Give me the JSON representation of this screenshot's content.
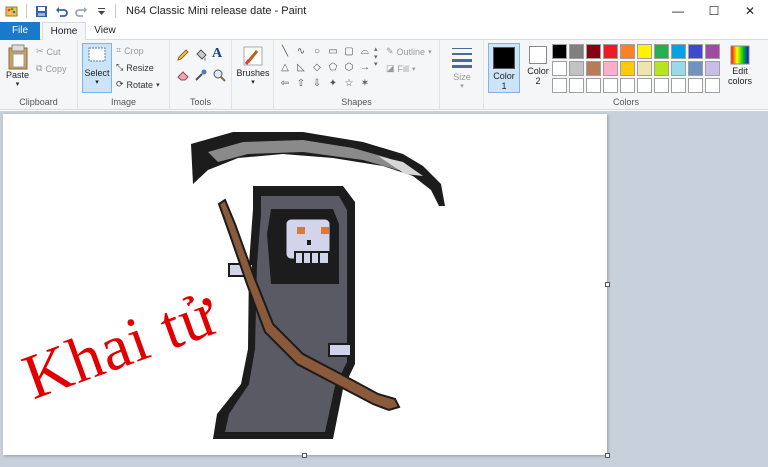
{
  "window": {
    "title": "N64 Classic Mini release date - Paint",
    "quick_access": [
      "paint-app-icon",
      "save-icon",
      "undo-icon",
      "redo-icon",
      "customize-qat-icon"
    ],
    "controls": {
      "minimize": "—",
      "maximize": "☐",
      "close": "✕"
    }
  },
  "tabs": {
    "file": "File",
    "home": "Home",
    "view": "View"
  },
  "ribbon": {
    "clipboard": {
      "label": "Clipboard",
      "paste": "Paste",
      "cut": "Cut",
      "copy": "Copy"
    },
    "image": {
      "label": "Image",
      "select": "Select",
      "crop": "Crop",
      "resize": "Resize",
      "rotate": "Rotate"
    },
    "tools": {
      "label": "Tools"
    },
    "brushes": {
      "label": "Brushes"
    },
    "shapes": {
      "label": "Shapes",
      "outline": "Outline",
      "fill": "Fill",
      "glyphs": [
        "╲",
        "∿",
        "○",
        "▭",
        "▢",
        "⌓",
        "△",
        "◺",
        "◇",
        "⬠",
        "⬡",
        "→",
        "⇦",
        "⇧",
        "⇩",
        "✦",
        "☆",
        "✶"
      ]
    },
    "size": {
      "label": "Size"
    },
    "colors": {
      "label": "Colors",
      "color1_label": "Color",
      "color1_num": "1",
      "color2_label": "Color",
      "color2_num": "2",
      "color1": "#000000",
      "color2": "#ffffff",
      "edit_label_1": "Edit",
      "edit_label_2": "colors",
      "palette": [
        "#000000",
        "#7f7f7f",
        "#880015",
        "#ed1c24",
        "#ff7f27",
        "#fff200",
        "#22b14c",
        "#00a2e8",
        "#3f48cc",
        "#a349a4",
        "#ffffff",
        "#c3c3c3",
        "#b97a57",
        "#ffaec9",
        "#ffc90e",
        "#efe4b0",
        "#b5e61d",
        "#99d9ea",
        "#7092be",
        "#c8bfe7",
        "#ffffff",
        "#ffffff",
        "#ffffff",
        "#ffffff",
        "#ffffff",
        "#ffffff",
        "#ffffff",
        "#ffffff",
        "#ffffff",
        "#ffffff"
      ]
    }
  },
  "canvas": {
    "overlay_text": "Khai tử",
    "overlay_color": "#e00000",
    "artwork": "pixel-art grim reaper with scythe"
  }
}
